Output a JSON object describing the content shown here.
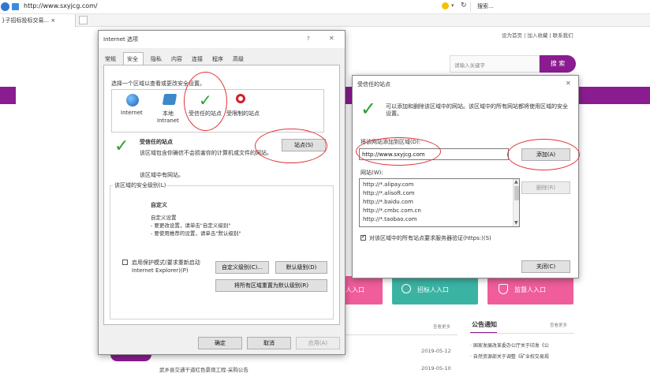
{
  "browser": {
    "url": "http://www.sxyjcg.com/",
    "search_label": "搜索...",
    "tab_title": "}子招标投标交易... ×"
  },
  "site": {
    "top_links": "设为首页 | 加入收藏 | 联系我们",
    "search_placeholder": "请输入关键字",
    "search_button": "搜 索",
    "entry_buyer": "理人入口",
    "entry_bidder": "招标人入口",
    "entry_supervisor": "监督人入口",
    "section_more_left": "查看更多",
    "notice_title": "公告通知",
    "notice_more": "查看更多",
    "notice_items": [
      "· 国家发展改革委办公厅关于印发《公",
      "· 自然资源部关于调整《矿业权交易规"
    ],
    "list_dates": [
      "2019-05-12",
      "2019-05-10"
    ],
    "list_item_2": "武乡县交通干道红色景观工程-采购公告"
  },
  "options_dialog": {
    "title": "Internet 选项",
    "help": "?",
    "close": "✕",
    "tabs": [
      "常规",
      "安全",
      "隐私",
      "内容",
      "连接",
      "程序",
      "高级"
    ],
    "zone_prompt": "选择一个区域以查看或更改安全设置。",
    "zones": [
      "Internet",
      "本地\nIntranet",
      "受信任的站点",
      "受限制的站点"
    ],
    "selected_zone_title": "受信任的站点",
    "selected_zone_desc": "该区域包含你确信不会损害你的计算机或文件的网站。",
    "zone_has_sites": "该区域中有网站。",
    "sites_button": "站点(S)",
    "security_level_group": "该区域的安全级别(L)",
    "custom_title": "自定义",
    "custom_lines": [
      "自定义设置",
      "- 要更改设置，请单击\"自定义级别\"",
      "- 要使用推荐的设置，请单击\"默认级别\""
    ],
    "protected_mode": "启用保护模式(要求重新启动\nInternet Explorer)(P)",
    "custom_level_button": "自定义级别(C)...",
    "default_level_button": "默认级别(D)",
    "reset_all_button": "将所有区域重置为默认级别(R)",
    "ok_button": "确定",
    "cancel_button": "取消",
    "apply_button": "应用(A)"
  },
  "trusted_dialog": {
    "title": "受信任的站点",
    "close": "✕",
    "info": "可以添加和删除该区域中的网站。该区域中的所有网站都将使用区域的安全设置。",
    "add_label": "将该网站添加到区域(D):",
    "add_value": "http://www.sxyjcg.com",
    "add_button": "添加(A)",
    "sites_label": "网站(W):",
    "sites": [
      "http://*.alipay.com",
      "http://*.alisoft.com",
      "http://*.baidu.com",
      "http://*.cmbc.com.cn",
      "http://*.taobao.com"
    ],
    "remove_button": "删除(R)",
    "https_checkbox": "对该区域中的所有站点要求服务器验证(https:)(S)",
    "close_button": "关闭(C)"
  },
  "colors": {
    "accent_purple": "#8a1c8f",
    "entry_pink": "#ef5d9b",
    "entry_green": "#3bb3a3",
    "annotation_red": "#e0343a"
  }
}
